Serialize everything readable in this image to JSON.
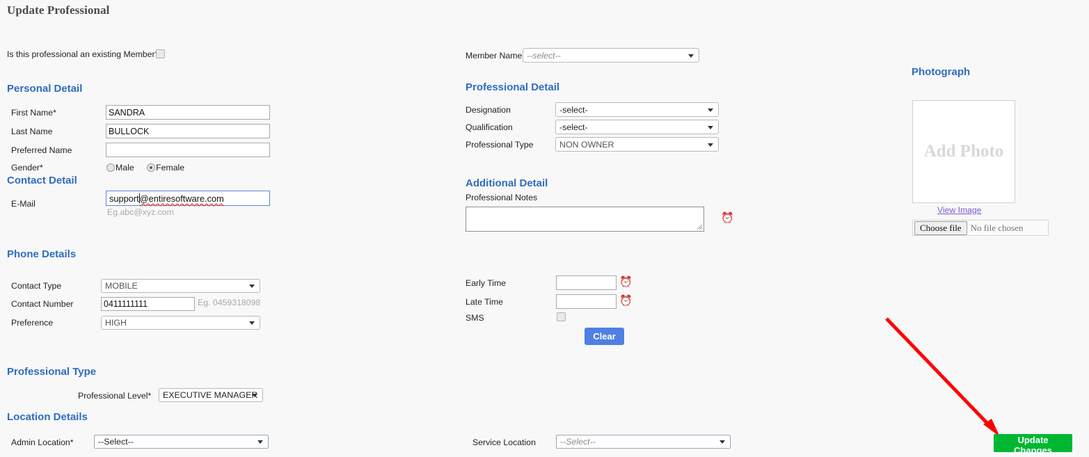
{
  "page": {
    "title": "Update Professional"
  },
  "member_question": {
    "label": "Is this professional an existing Member?",
    "checked": false
  },
  "member_name": {
    "label": "Member Name",
    "value": "--select--"
  },
  "sections": {
    "personal": "Personal Detail",
    "contact": "Contact Detail",
    "phone": "Phone Details",
    "professional_type": "Professional Type",
    "location": "Location Details",
    "professional_detail": "Professional Detail",
    "additional_detail": "Additional Detail",
    "photograph": "Photograph"
  },
  "personal": {
    "first_name": {
      "label": "First Name*",
      "value": "SANDRA"
    },
    "last_name": {
      "label": "Last Name",
      "value": "BULLOCK"
    },
    "preferred_name": {
      "label": "Preferred Name",
      "value": ""
    },
    "gender": {
      "label": "Gender*",
      "options": [
        "Male",
        "Female"
      ],
      "selected": "Female"
    }
  },
  "contact": {
    "email": {
      "label": "E-Mail",
      "value_before_caret": "support",
      "value_after_caret": "@entiresoftware.com",
      "hint": "Eg.abc@xyz.com"
    }
  },
  "phone": {
    "contact_type": {
      "label": "Contact Type",
      "value": "MOBILE"
    },
    "contact_number": {
      "label": "Contact Number",
      "value": "0411111111",
      "hint": "Eg. 0459318098"
    },
    "preference": {
      "label": "Preference",
      "value": "HIGH"
    }
  },
  "professional_type_section": {
    "professional_level": {
      "label": "Professional Level*",
      "value": "EXECUTIVE MANAGER"
    }
  },
  "location": {
    "admin_location": {
      "label": "Admin Location*",
      "value": "--Select--"
    },
    "service_location": {
      "label": "Service Location",
      "value": "--Select--"
    }
  },
  "professional_detail": {
    "designation": {
      "label": "Designation",
      "value": "-select-"
    },
    "qualification": {
      "label": "Qualification",
      "value": "-select-"
    },
    "professional_type": {
      "label": "Professional Type",
      "value": "NON OWNER"
    }
  },
  "additional_detail": {
    "notes": {
      "label": "Professional Notes",
      "value": ""
    },
    "early_time": {
      "label": "Early Time",
      "value": ""
    },
    "late_time": {
      "label": "Late Time",
      "value": ""
    },
    "sms": {
      "label": "SMS",
      "checked": false
    },
    "clear_button": "Clear"
  },
  "photograph": {
    "placeholder": "Add Photo",
    "view_image": "View Image",
    "choose_file": "Choose file",
    "no_file": "No file chosen"
  },
  "footer": {
    "update_button": "Update Changes"
  },
  "icons": {
    "clock": "⏰"
  },
  "colors": {
    "section_heading": "#2f6cc0",
    "clear_button": "#4f7fe0",
    "update_button": "#00b733",
    "annotation_arrow": "#ff0000",
    "link": "#7a5ad6"
  }
}
